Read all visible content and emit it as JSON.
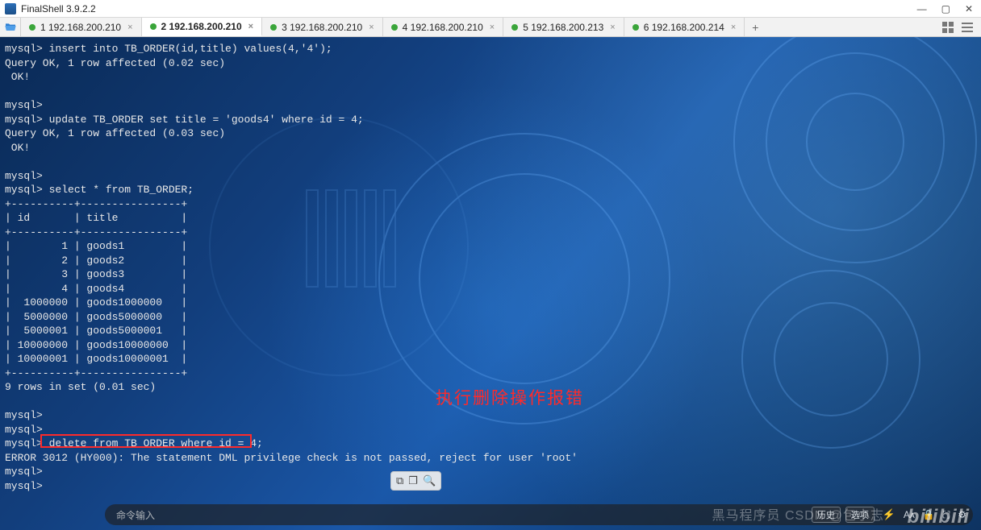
{
  "window": {
    "title": "FinalShell 3.9.2.2",
    "controls": {
      "min": "—",
      "max": "▢",
      "close": "✕"
    }
  },
  "tabs": [
    {
      "label": "1 192.168.200.210",
      "active": false
    },
    {
      "label": "2 192.168.200.210",
      "active": true
    },
    {
      "label": "3 192.168.200.210",
      "active": false
    },
    {
      "label": "4 192.168.200.210",
      "active": false
    },
    {
      "label": "5 192.168.200.213",
      "active": false
    },
    {
      "label": "6 192.168.200.214",
      "active": false
    }
  ],
  "tab_add": "+",
  "terminal": {
    "lines": [
      "mysql> insert into TB_ORDER(id,title) values(4,'4');",
      "Query OK, 1 row affected (0.02 sec)",
      " OK!",
      "",
      "mysql>",
      "mysql> update TB_ORDER set title = 'goods4' where id = 4;",
      "Query OK, 1 row affected (0.03 sec)",
      " OK!",
      "",
      "mysql>",
      "mysql> select * from TB_ORDER;",
      "+----------+----------------+",
      "| id       | title          |",
      "+----------+----------------+",
      "|        1 | goods1         |",
      "|        2 | goods2         |",
      "|        3 | goods3         |",
      "|        4 | goods4         |",
      "|  1000000 | goods1000000   |",
      "|  5000000 | goods5000000   |",
      "|  5000001 | goods5000001   |",
      "| 10000000 | goods10000000  |",
      "| 10000001 | goods10000001  |",
      "+----------+----------------+",
      "9 rows in set (0.01 sec)",
      "",
      "mysql>",
      "mysql>",
      "mysql> delete from TB_ORDER where id = 4;",
      "ERROR 3012 (HY000): The statement DML privilege check is not passed, reject for user 'root'",
      "mysql>",
      "mysql>"
    ]
  },
  "annotation": "执行删除操作报错",
  "cmdbar": {
    "placeholder": "命令输入",
    "history": "历史",
    "options": "选项"
  },
  "watermark": {
    "text1": "黑马程序员  CSDN @包小志",
    "text2": "bilibili"
  },
  "float_tools": {
    "copy": "⧉",
    "clip": "❐",
    "search": "🔍"
  }
}
